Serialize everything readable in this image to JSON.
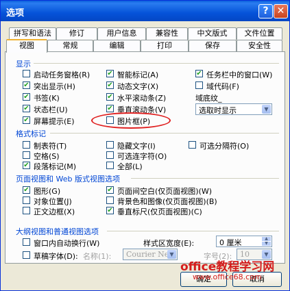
{
  "window": {
    "title": "选项",
    "help_glyph": "?",
    "close_glyph": "✕"
  },
  "tabs_row1": [
    "拼写和语法",
    "修订",
    "用户信息",
    "兼容性",
    "中文版式",
    "文件位置"
  ],
  "tabs_row2": [
    "视图",
    "常规",
    "编辑",
    "打印",
    "保存",
    "安全性"
  ],
  "active_tab": "视图",
  "display": {
    "title": "显示",
    "col1": [
      {
        "label": "启动任务窗格(R)",
        "checked": false
      },
      {
        "label": "突出显示(H)",
        "checked": true
      },
      {
        "label": "书签(K)",
        "checked": true
      },
      {
        "label": "状态栏(U)",
        "checked": true
      },
      {
        "label": "屏幕提示(E)",
        "checked": true
      }
    ],
    "col2": [
      {
        "label": "智能标记(A)",
        "checked": true
      },
      {
        "label": "动态文字(X)",
        "checked": true
      },
      {
        "label": "水平滚动条(Z)",
        "checked": true
      },
      {
        "label": "垂直滚动条(V)",
        "checked": true
      },
      {
        "label": "图片框(P)",
        "checked": false
      }
    ],
    "col3": [
      {
        "label": "任务栏中的窗口(W)",
        "checked": true
      },
      {
        "label": "域代码(F)",
        "checked": false
      }
    ],
    "field_shading_label": "域底纹_",
    "field_shading_value": "选取时显示"
  },
  "format_marks": {
    "title": "格式标记",
    "col1": [
      {
        "label": "制表符(T)",
        "checked": false
      },
      {
        "label": "空格(S)",
        "checked": false
      },
      {
        "label": "段落标记(M)",
        "checked": true
      }
    ],
    "col2": [
      {
        "label": "隐藏文字(I)",
        "checked": false
      },
      {
        "label": "可选连字符(O)",
        "checked": false
      },
      {
        "label": "全部(L)",
        "checked": false
      }
    ],
    "col3": [
      {
        "label": "可选分隔符(O)",
        "checked": false
      }
    ]
  },
  "page_view": {
    "title": "页面视图和 Web 版式视图选项",
    "col1": [
      {
        "label": "图形(G)",
        "checked": true
      },
      {
        "label": "对象位置(J)",
        "checked": false
      },
      {
        "label": "正文边框(X)",
        "checked": false
      }
    ],
    "col2": [
      {
        "label": "页面间空白(仅页面视图)(W)",
        "checked": true
      },
      {
        "label": "背景色和图像(仅页面视图)(B)",
        "checked": false
      },
      {
        "label": "垂直标尺(仅页面视图)(C)",
        "checked": true
      }
    ]
  },
  "outline_view": {
    "title": "大纲视图和普通视图选项",
    "wrap_label": "窗口内自动换行(W)",
    "wrap_checked": false,
    "style_width_label": "样式区宽度(E):",
    "style_width_value": "0 厘米",
    "draft_label": "草稿字体(D):",
    "draft_checked": false,
    "name_label": "名称(1):",
    "font_name": "Courier New",
    "size_label": "字号(2):",
    "size_value": "10"
  },
  "buttons": {
    "ok": "确定",
    "cancel": "取消"
  },
  "watermark": {
    "line1": "office教程学习网",
    "line2": "www.office68.com"
  },
  "colors": {
    "title_bar": "#0a5fdc",
    "group_title": "#0046d5",
    "highlight_oval": "#e02020"
  }
}
